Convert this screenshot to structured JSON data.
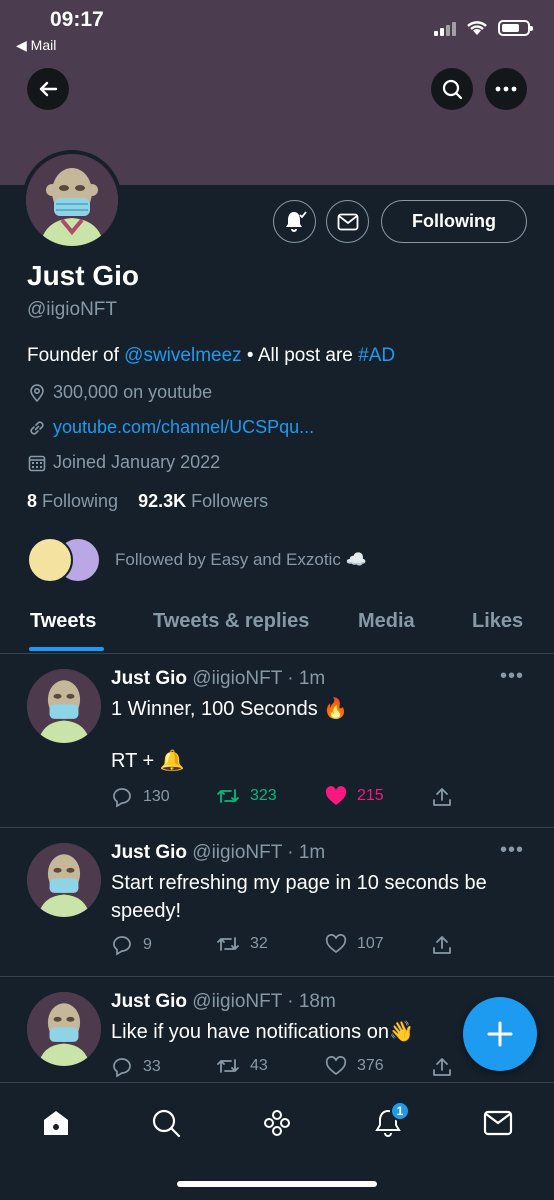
{
  "status_bar": {
    "time": "09:17",
    "back_app": "◀ Mail"
  },
  "profile": {
    "display_name": "Just Gio",
    "handle": "@iigioNFT",
    "bio_prefix": "Founder of ",
    "bio_mention": "@swivelmeez",
    "bio_middle": " • All post are ",
    "bio_hashtag": "#AD",
    "location": "300,000 on youtube",
    "url": "youtube.com/channel/UCSPqu...",
    "joined": "Joined January 2022",
    "following_count": "8",
    "following_label": "Following",
    "followers_count": "92.3K",
    "followers_label": "Followers",
    "followed_by": "Followed by Easy and Exzotic ☁️",
    "follow_button": "Following"
  },
  "tabs": [
    {
      "label": "Tweets",
      "active": true
    },
    {
      "label": "Tweets & replies",
      "active": false
    },
    {
      "label": "Media",
      "active": false
    },
    {
      "label": "Likes",
      "active": false
    }
  ],
  "tweets": [
    {
      "name": "Just Gio",
      "meta": "@iigioNFT · 1m",
      "text_line1": "1 Winner, 100 Seconds 🔥",
      "text_line2": "RT + 🔔",
      "replies": "130",
      "retweets": "323",
      "likes": "215",
      "retweeted": true,
      "liked": true
    },
    {
      "name": "Just Gio",
      "meta": "@iigioNFT · 1m",
      "text_line1": "Start refreshing my page in 10 seconds be",
      "text_line2": "speedy!",
      "replies": "9",
      "retweets": "32",
      "likes": "107",
      "retweeted": false,
      "liked": false
    },
    {
      "name": "Just Gio",
      "meta": "@iigioNFT · 18m",
      "text_line1": "Like if you have notifications on👋",
      "text_line2": "",
      "replies": "33",
      "retweets": "43",
      "likes": "376",
      "retweeted": false,
      "liked": false
    }
  ],
  "bottom_nav": {
    "notifications_badge": "1"
  },
  "colors": {
    "background": "#15202b",
    "banner": "#4b3d4f",
    "accent": "#1d9bf0",
    "retweet_green": "#00ba7c",
    "like_pink": "#f91880",
    "muted": "#8899a6"
  }
}
